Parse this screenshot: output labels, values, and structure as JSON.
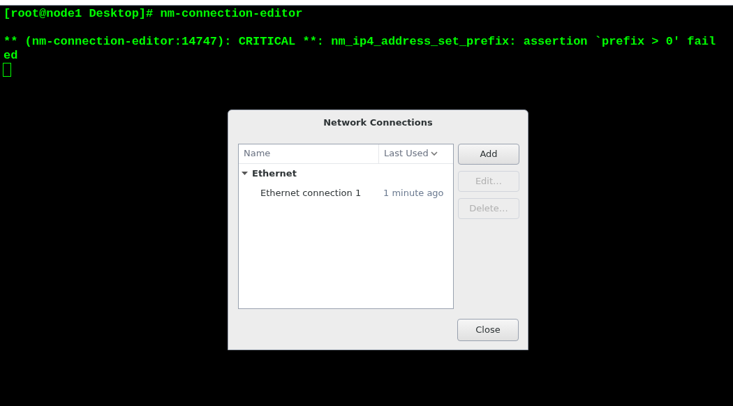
{
  "terminal": {
    "lines": [
      "[root@node1 Desktop]# nm-connection-editor",
      "** (nm-connection-editor:14747): CRITICAL **: nm_ip4_address_set_prefix: assertion `prefix > 0' fail",
      "ed"
    ]
  },
  "dialog": {
    "title": "Network Connections",
    "table": {
      "columns": [
        {
          "label": "Name",
          "sorted": false
        },
        {
          "label": "Last Used",
          "sorted": true
        }
      ],
      "groups": [
        {
          "label": "Ethernet",
          "expanded": true,
          "children": [
            {
              "name": "Ethernet connection 1",
              "last_used": "1 minute ago"
            }
          ]
        }
      ]
    },
    "buttons": [
      {
        "label": "Add",
        "disabled": false
      },
      {
        "label": "Edit…",
        "disabled": true
      },
      {
        "label": "Delete…",
        "disabled": true
      }
    ],
    "close_button": {
      "label": "Close"
    }
  }
}
